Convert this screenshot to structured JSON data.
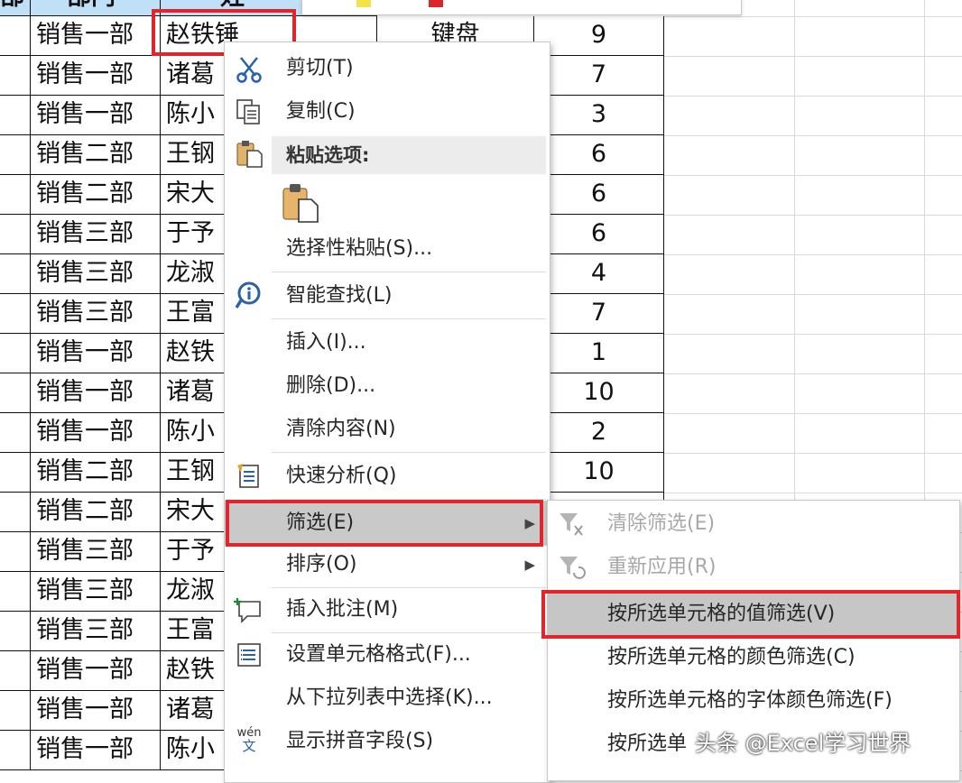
{
  "sheet": {
    "header": [
      "部",
      "部门",
      "姓"
    ],
    "selected_cell": {
      "dept": "销售一部",
      "name": "赵铁锤",
      "item": "键盘",
      "qty": "9"
    },
    "rows": [
      {
        "dept": "销售一部",
        "name": "诸葛",
        "qty": "7"
      },
      {
        "dept": "销售一部",
        "name": "陈小",
        "qty": "3"
      },
      {
        "dept": "销售二部",
        "name": "王钢",
        "qty": "6"
      },
      {
        "dept": "销售二部",
        "name": "宋大",
        "qty": "6"
      },
      {
        "dept": "销售三部",
        "name": "于予",
        "qty": "6"
      },
      {
        "dept": "销售三部",
        "name": "龙淑",
        "qty": "4"
      },
      {
        "dept": "销售三部",
        "name": "王富",
        "qty": "7"
      },
      {
        "dept": "销售一部",
        "name": "赵铁",
        "qty": "1"
      },
      {
        "dept": "销售一部",
        "name": "诸葛",
        "qty": "10"
      },
      {
        "dept": "销售一部",
        "name": "陈小",
        "qty": "2"
      },
      {
        "dept": "销售二部",
        "name": "王钢",
        "qty": "10"
      },
      {
        "dept": "销售二部",
        "name": "宋大",
        "qty": ""
      },
      {
        "dept": "销售三部",
        "name": "于予",
        "qty": ""
      },
      {
        "dept": "销售三部",
        "name": "龙淑",
        "qty": ""
      },
      {
        "dept": "销售三部",
        "name": "王富",
        "qty": ""
      },
      {
        "dept": "销售一部",
        "name": "赵铁",
        "qty": ""
      },
      {
        "dept": "销售一部",
        "name": "诸葛",
        "qty": ""
      },
      {
        "dept": "销售一部",
        "name": "陈小",
        "qty": ""
      }
    ]
  },
  "context_menu": {
    "cut": "剪切(T)",
    "copy": "复制(C)",
    "paste_options": "粘贴选项:",
    "paste_special": "选择性粘贴(S)...",
    "smart_lookup": "智能查找(L)",
    "insert": "插入(I)...",
    "delete": "删除(D)...",
    "clear_contents": "清除内容(N)",
    "quick_analysis": "快速分析(Q)",
    "filter": "筛选(E)",
    "sort": "排序(O)",
    "insert_comment": "插入批注(M)",
    "format_cells": "设置单元格格式(F)...",
    "pick_from_list": "从下拉列表中选择(K)...",
    "show_phonetic": "显示拼音字段(S)",
    "phonetic_icon_text": "wén",
    "phonetic_icon_char": "文",
    "submenu_arrow": "▶"
  },
  "filter_submenu": {
    "clear_filter": "清除筛选(E)",
    "reapply": "重新应用(R)",
    "by_value": "按所选单元格的值筛选(V)",
    "by_color": "按所选单元格的颜色筛选(C)",
    "by_font_color": "按所选单元格的字体颜色筛选(F)",
    "by_icon": "按所选单"
  },
  "watermark": "头条 @Excel学习世界",
  "colors": {
    "highlight_red": "#e0262b",
    "menu_hover": "#c9c9c9",
    "header_blue": "#bfe0f6"
  }
}
